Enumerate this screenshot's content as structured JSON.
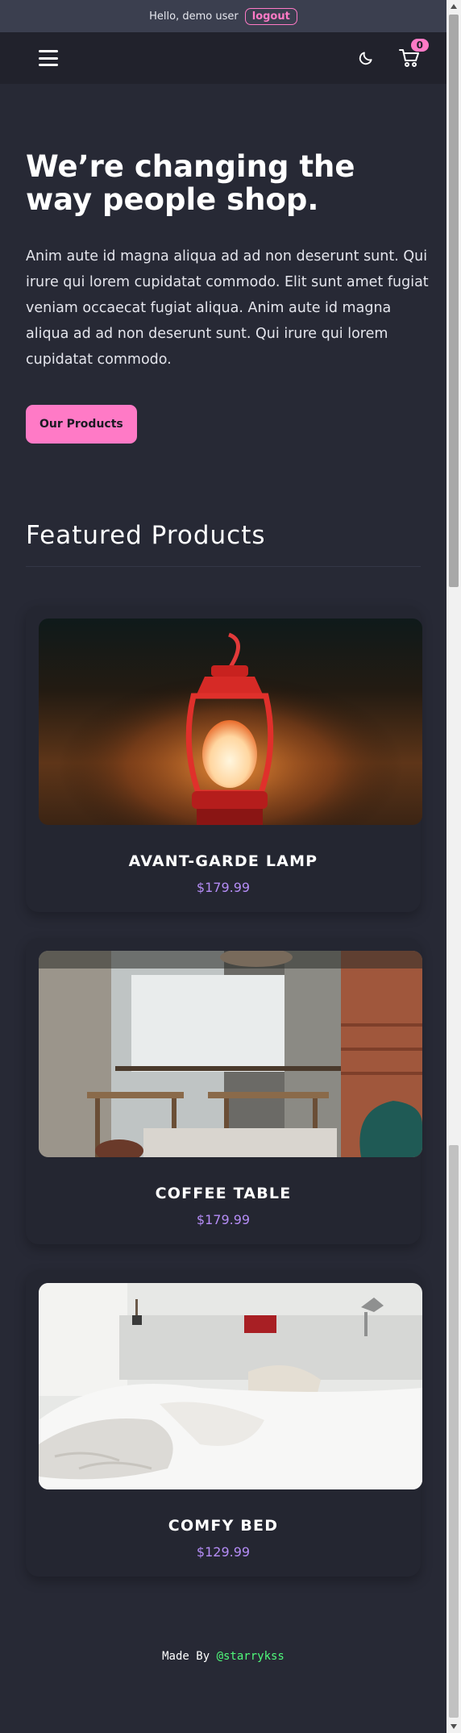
{
  "topbar": {
    "greeting": "Hello, demo user",
    "logout_label": "logout"
  },
  "navbar": {
    "menu_icon": "hamburger-menu-icon",
    "theme_icon": "moon-icon",
    "cart_icon": "cart-icon",
    "cart_count": "0"
  },
  "hero": {
    "title": "We’re changing the way people shop.",
    "body": "Anim aute id magna aliqua ad ad non deserunt sunt. Qui irure qui lorem cupidatat commodo. Elit sunt amet fugiat veniam occaecat fugiat aliqua. Anim aute id magna aliqua ad ad non deserunt sunt. Qui irure qui lorem cupidatat commodo.",
    "cta_label": "Our Products"
  },
  "featured": {
    "title": "Featured Products",
    "products": [
      {
        "name": "AVANT-GARDE LAMP",
        "price": "$179.99"
      },
      {
        "name": "COFFEE TABLE",
        "price": "$179.99"
      },
      {
        "name": "COMFY BED",
        "price": "$129.99"
      }
    ]
  },
  "footer": {
    "prefix": "Made By ",
    "handle": "@starrykss"
  },
  "colors": {
    "accent": "#ff7ac6",
    "price": "#b48cf5",
    "handle": "#50fa7b",
    "bg": "#272935"
  }
}
